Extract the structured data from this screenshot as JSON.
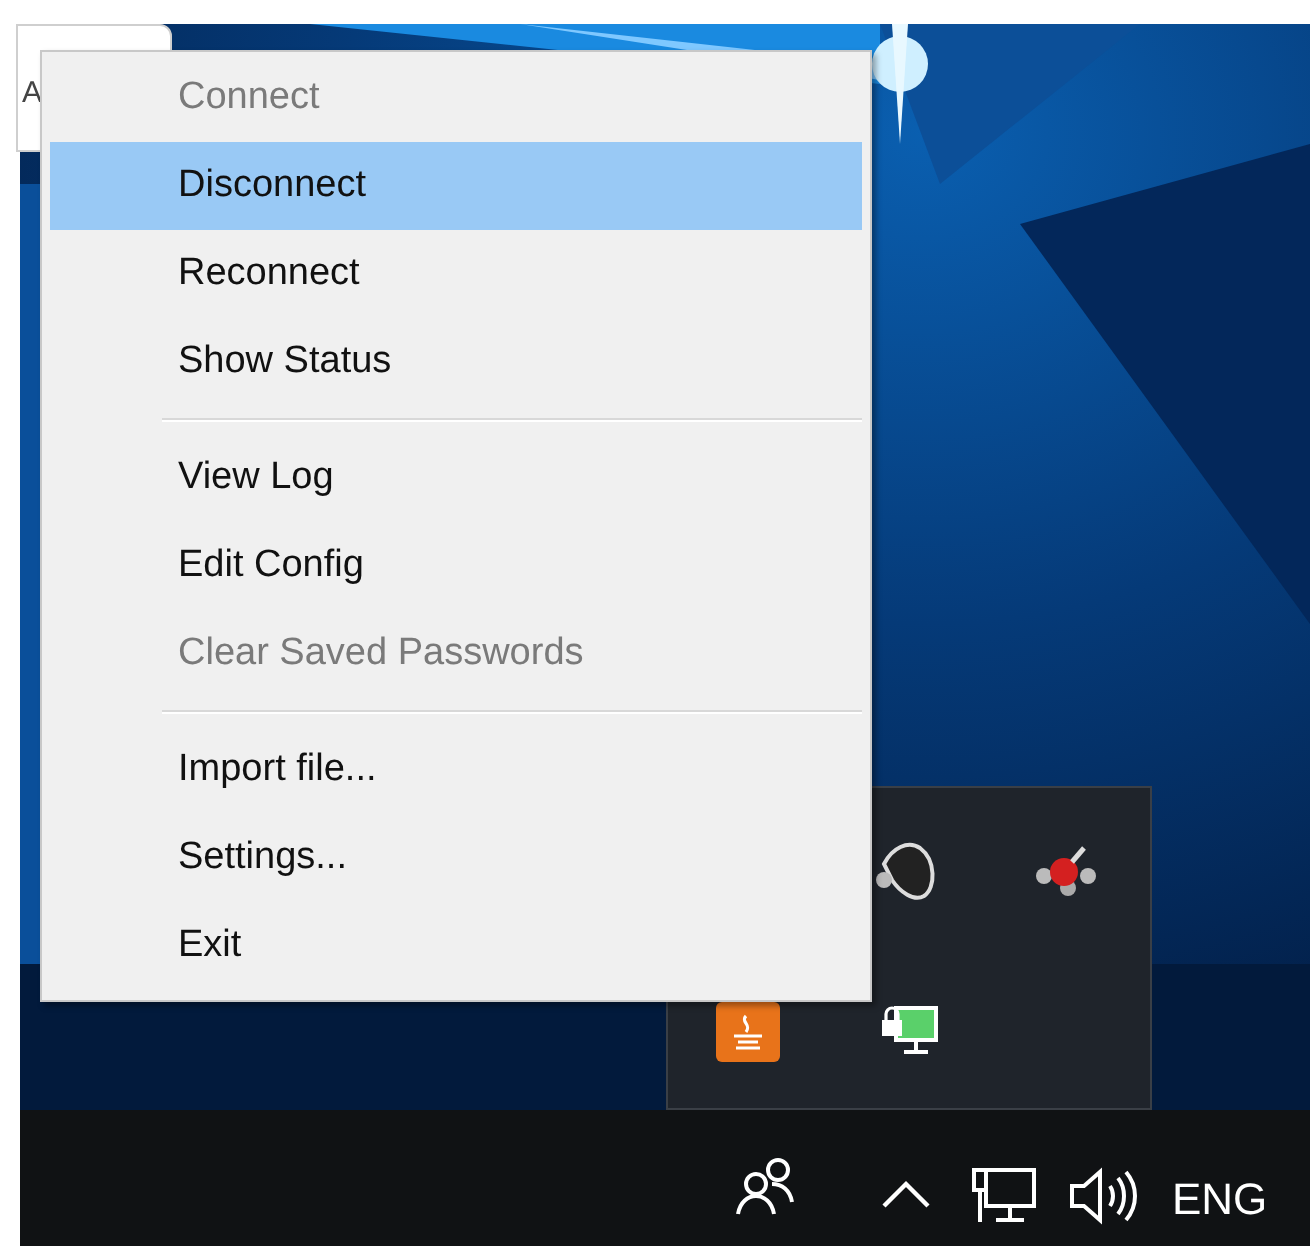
{
  "background_window": {
    "text": "A"
  },
  "menu": {
    "items": [
      {
        "label": "Connect",
        "disabled": true,
        "selected": false,
        "separator_after": false
      },
      {
        "label": "Disconnect",
        "disabled": false,
        "selected": true,
        "separator_after": false
      },
      {
        "label": "Reconnect",
        "disabled": false,
        "selected": false,
        "separator_after": false
      },
      {
        "label": "Show Status",
        "disabled": false,
        "selected": false,
        "separator_after": true
      },
      {
        "label": "View Log",
        "disabled": false,
        "selected": false,
        "separator_after": false
      },
      {
        "label": "Edit Config",
        "disabled": false,
        "selected": false,
        "separator_after": false
      },
      {
        "label": "Clear Saved Passwords",
        "disabled": true,
        "selected": false,
        "separator_after": true
      },
      {
        "label": "Import file...",
        "disabled": false,
        "selected": false,
        "separator_after": false
      },
      {
        "label": "Settings...",
        "disabled": false,
        "selected": false,
        "separator_after": false
      },
      {
        "label": "Exit",
        "disabled": false,
        "selected": false,
        "separator_after": false
      }
    ]
  },
  "taskbar": {
    "language": "ENG"
  }
}
